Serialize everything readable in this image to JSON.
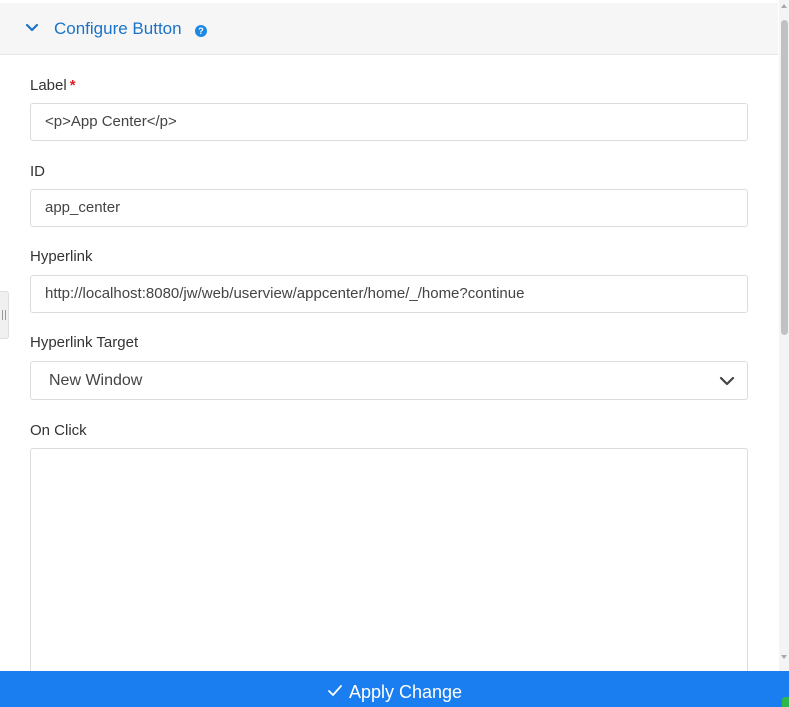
{
  "section": {
    "title": "Configure Button",
    "help_icon": "question-circle-icon",
    "toggle_icon": "chevron-down-icon"
  },
  "fields": {
    "label": {
      "label": "Label",
      "required_mark": "*",
      "value": "<p>App Center</p>"
    },
    "id": {
      "label": "ID",
      "value": "app_center"
    },
    "hyperlink": {
      "label": "Hyperlink",
      "value": "http://localhost:8080/jw/web/userview/appcenter/home/_/home?continue"
    },
    "hyperlink_target": {
      "label": "Hyperlink Target",
      "selected": "New Window"
    },
    "on_click": {
      "label": "On Click",
      "value": ""
    }
  },
  "footer": {
    "apply_label": "Apply Change",
    "apply_icon": "checkmark-icon"
  },
  "colors": {
    "accent": "#1a73c8",
    "apply_bar": "#1a7df0",
    "required": "#e02020",
    "help_icon_bg": "#1e88e5"
  }
}
